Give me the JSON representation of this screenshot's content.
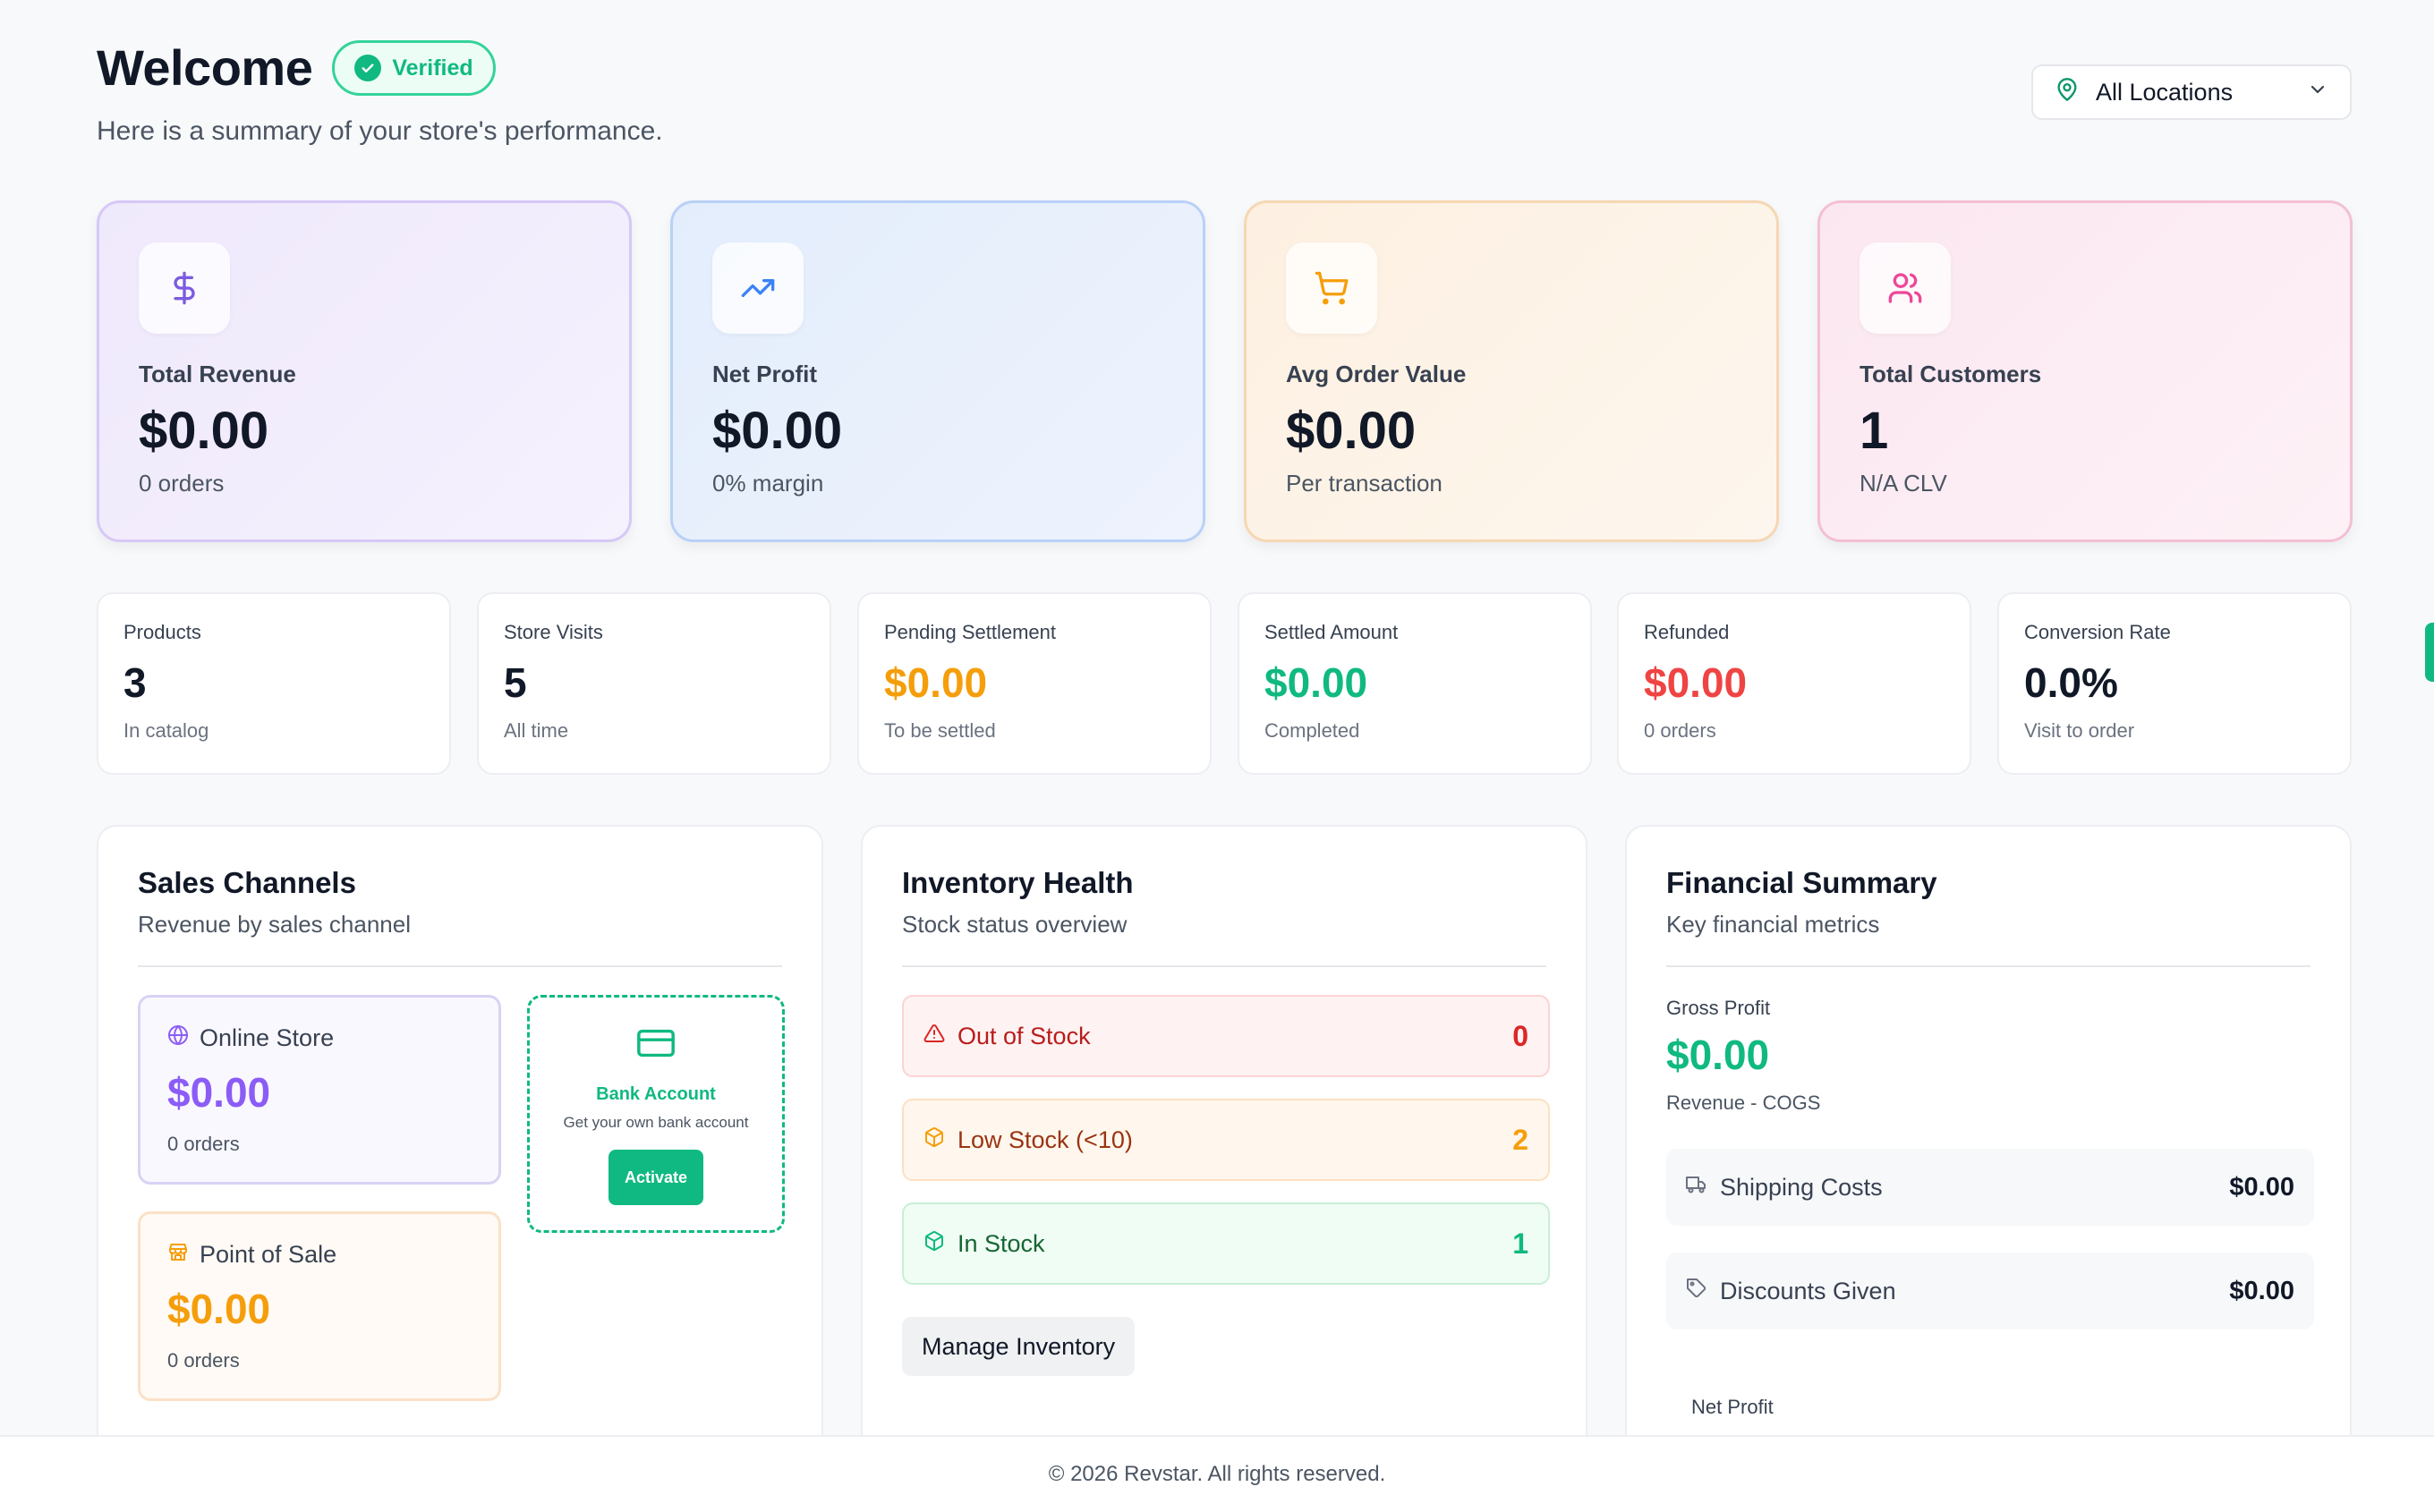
{
  "header": {
    "title": "Welcome",
    "verified_label": "Verified",
    "subtitle": "Here is a summary of your store's performance.",
    "location_select": "All Locations"
  },
  "metrics": [
    {
      "label": "Total Revenue",
      "value": "$0.00",
      "sub": "0 orders",
      "icon": "dollar-icon",
      "accent": "#7c5ce0"
    },
    {
      "label": "Net Profit",
      "value": "$0.00",
      "sub": "0% margin",
      "icon": "trending-up-icon",
      "accent": "#3b82f6"
    },
    {
      "label": "Avg Order Value",
      "value": "$0.00",
      "sub": "Per transaction",
      "icon": "cart-icon",
      "accent": "#f59e0b"
    },
    {
      "label": "Total Customers",
      "value": "1",
      "sub": "N/A CLV",
      "icon": "users-icon",
      "accent": "#ec4899"
    }
  ],
  "stats": [
    {
      "label": "Products",
      "value": "3",
      "sub": "In catalog",
      "color": "#111827"
    },
    {
      "label": "Store Visits",
      "value": "5",
      "sub": "All time",
      "color": "#111827"
    },
    {
      "label": "Pending Settlement",
      "value": "$0.00",
      "sub": "To be settled",
      "color": "#f59e0b"
    },
    {
      "label": "Settled Amount",
      "value": "$0.00",
      "sub": "Completed",
      "color": "#10b981"
    },
    {
      "label": "Refunded",
      "value": "$0.00",
      "sub": "0 orders",
      "color": "#ef4444"
    },
    {
      "label": "Conversion Rate",
      "value": "0.0%",
      "sub": "Visit to order",
      "color": "#111827"
    }
  ],
  "sales_channels": {
    "title": "Sales Channels",
    "subtitle": "Revenue by sales channel",
    "online": {
      "name": "Online Store",
      "value": "$0.00",
      "sub": "0 orders"
    },
    "pos": {
      "name": "Point of Sale",
      "value": "$0.00",
      "sub": "0 orders"
    },
    "bank": {
      "name": "Bank Account",
      "sub": "Get your own bank account",
      "button": "Activate"
    }
  },
  "inventory": {
    "title": "Inventory Health",
    "subtitle": "Stock status overview",
    "out_of_stock": {
      "label": "Out of Stock",
      "count": "0"
    },
    "low_stock": {
      "label": "Low Stock (<10)",
      "count": "2"
    },
    "in_stock": {
      "label": "In Stock",
      "count": "1"
    },
    "manage_button": "Manage Inventory"
  },
  "financial": {
    "title": "Financial Summary",
    "subtitle": "Key financial metrics",
    "gross_label": "Gross Profit",
    "gross_value": "$0.00",
    "gross_sub": "Revenue - COGS",
    "shipping_label": "Shipping Costs",
    "shipping_value": "$0.00",
    "discounts_label": "Discounts Given",
    "discounts_value": "$0.00",
    "net_label": "Net Profit"
  },
  "footer": {
    "text": "© 2026 Revstar. All rights reserved."
  }
}
